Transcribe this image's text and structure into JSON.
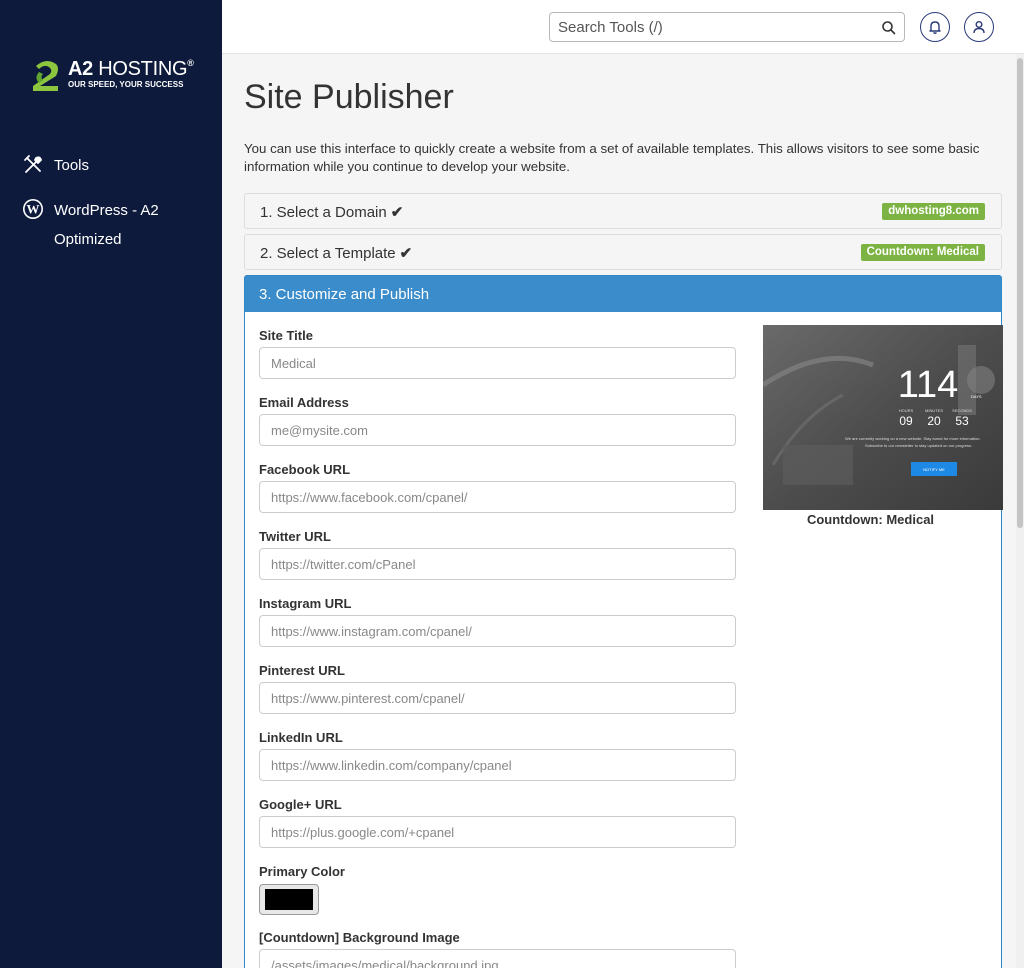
{
  "brand": {
    "name_bold": "A2",
    "name_light": "HOSTING",
    "registered": "®",
    "tagline": "OUR SPEED, YOUR SUCCESS"
  },
  "sidebar": {
    "items": [
      {
        "label": "Tools",
        "icon": "tools-icon"
      },
      {
        "label": "WordPress - A2 Optimized",
        "icon": "wordpress-icon"
      }
    ]
  },
  "header": {
    "search_placeholder": "Search Tools (/)"
  },
  "page": {
    "title": "Site Publisher",
    "intro": "You can use this interface to quickly create a website from a set of available templates. This allows visitors to see some basic information while you continue to develop your website."
  },
  "steps": [
    {
      "title": "1. Select a Domain",
      "badge": "dwhosting8.com",
      "completed": true
    },
    {
      "title": "2. Select a Template",
      "badge": "Countdown: Medical",
      "completed": true
    },
    {
      "title": "3. Customize and Publish"
    }
  ],
  "form": {
    "fields": [
      {
        "label": "Site Title",
        "placeholder": "Medical"
      },
      {
        "label": "Email Address",
        "placeholder": "me@mysite.com"
      },
      {
        "label": "Facebook URL",
        "placeholder": "https://www.facebook.com/cpanel/"
      },
      {
        "label": "Twitter URL",
        "placeholder": "https://twitter.com/cPanel"
      },
      {
        "label": "Instagram URL",
        "placeholder": "https://www.instagram.com/cpanel/"
      },
      {
        "label": "Pinterest URL",
        "placeholder": "https://www.pinterest.com/cpanel/"
      },
      {
        "label": "LinkedIn URL",
        "placeholder": "https://www.linkedin.com/company/cpanel"
      },
      {
        "label": "Google+ URL",
        "placeholder": "https://plus.google.com/+cpanel"
      },
      {
        "label": "Primary Color"
      },
      {
        "label": "[Countdown] Background Image",
        "placeholder": "/assets/images/medical/background.jpg"
      }
    ],
    "primary_color_value": "#000000"
  },
  "preview": {
    "caption": "Countdown: Medical",
    "days": "114",
    "days_label": "DAYS",
    "hours_label": "HOURS",
    "minutes_label": "MINUTES",
    "seconds_label": "SECONDS",
    "hours": "09",
    "minutes": "20",
    "seconds": "53",
    "message_line1": "We are currently working on a new website. Stay tuned for more information.",
    "message_line2": "Subscribe to our newsletter to stay updated on our progress.",
    "button": "NOTIFY ME"
  },
  "colors": {
    "sidebar_bg": "#0d1a3c",
    "panel_header": "#3a8cca",
    "badge_green": "#7cb342",
    "notify_button": "#1e88e5"
  }
}
